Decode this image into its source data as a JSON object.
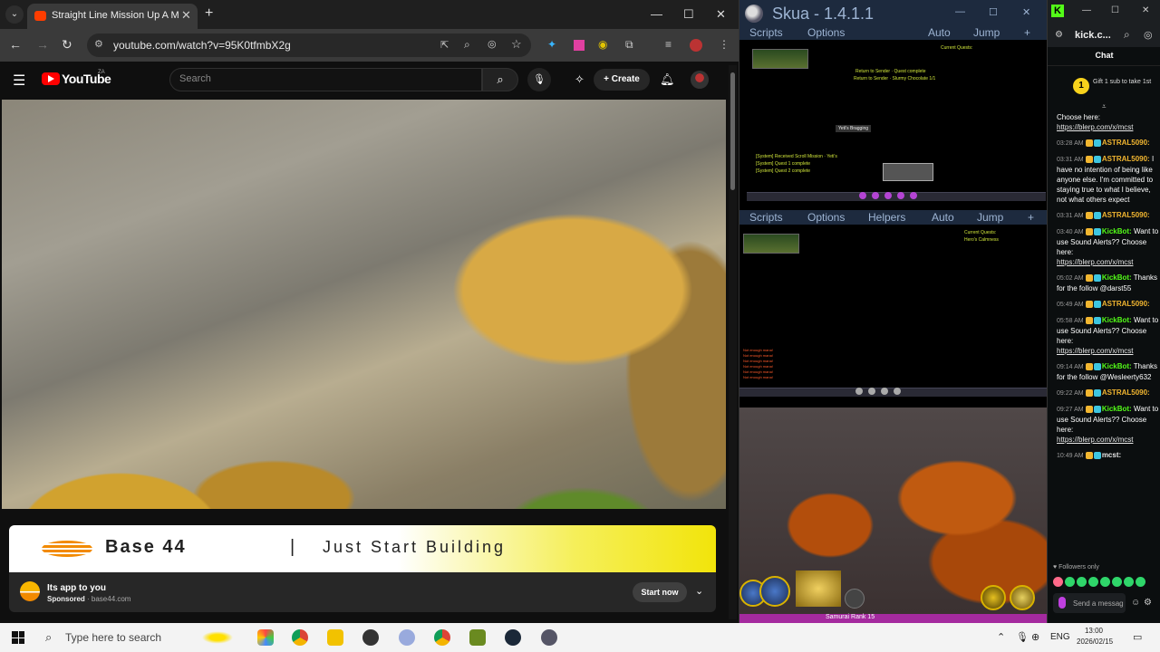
{
  "chrome": {
    "tab_title": "Straight Line Mission Up A M",
    "url": "youtube.com/watch?v=95K0tfmbX2g",
    "minimize_glyph": "—",
    "maximize_glyph": "☐",
    "close_glyph": "✕"
  },
  "youtube": {
    "logo_text": "YouTube",
    "country_code": "ZA",
    "search_placeholder": "Search",
    "create_label": "Create"
  },
  "ad": {
    "brand": "Base 44",
    "separator": "|",
    "slogan": "Just Start Building",
    "title": "Its app to you",
    "sponsored_label": "Sponsored",
    "domain": "base44.com",
    "cta": "Start now"
  },
  "skua": {
    "title": "Skua - 1.4.1.1",
    "menu_top": {
      "scripts": "Scripts",
      "options": "Options",
      "auto": "Auto",
      "jump": "Jump",
      "plus": "+"
    },
    "menu_bottom": {
      "scripts": "Scripts",
      "options": "Options",
      "helpers": "Helpers",
      "auto": "Auto",
      "jump": "Jump",
      "plus": "+"
    },
    "rank_text": "Samurai Rank 15"
  },
  "kick": {
    "url": "kick.c...",
    "chat_title": "Chat",
    "gift_count": "1",
    "gift_text": "Gift 1 sub to take 1st",
    "followers_only": "Followers only",
    "input_placeholder": "Send a message",
    "messages": [
      {
        "time": "",
        "user": "",
        "text": "Choose here:",
        "link": "https://blerp.com/x/mcst"
      },
      {
        "time": "03:28 AM",
        "user": "ASTRAL5090:",
        "text": "",
        "link": ""
      },
      {
        "time": "03:31 AM",
        "user": "ASTRAL5090:",
        "text": "I have no intention of being like anyone else. I'm committed to staying true to what I believe, not what others expect",
        "link": ""
      },
      {
        "time": "03:31 AM",
        "user": "ASTRAL5090:",
        "text": "",
        "link": ""
      },
      {
        "time": "03:40 AM",
        "user": "KickBot:",
        "text": "Want to use Sound Alerts?? Choose here:",
        "link": "https://blerp.com/x/mcst"
      },
      {
        "time": "05:02 AM",
        "user": "KickBot:",
        "text": "Thanks for the follow @darst55",
        "link": ""
      },
      {
        "time": "05:49 AM",
        "user": "ASTRAL5090:",
        "text": "",
        "link": ""
      },
      {
        "time": "05:58 AM",
        "user": "KickBot:",
        "text": "Want to use Sound Alerts?? Choose here:",
        "link": "https://blerp.com/x/mcst"
      },
      {
        "time": "09:14 AM",
        "user": "KickBot:",
        "text": "Thanks for the follow @Wesleerty632",
        "link": ""
      },
      {
        "time": "09:22 AM",
        "user": "ASTRAL5090:",
        "text": "",
        "link": ""
      },
      {
        "time": "09:27 AM",
        "user": "KickBot:",
        "text": "Want to use Sound Alerts?? Choose here:",
        "link": "https://blerp.com/x/mcst"
      },
      {
        "time": "10:49 AM",
        "user": "mcst:",
        "text": "",
        "link": ""
      }
    ]
  },
  "taskbar": {
    "search_placeholder": "Type here to search",
    "language": "ENG",
    "time": "13:00",
    "date": "2026/02/15"
  },
  "colors": {
    "youtube_red": "#ff0000",
    "kick_green": "#53fc18",
    "skua_title_bg": "#1d2a3e",
    "skua_text": "#9db4d3",
    "astral_user": "#f2b630",
    "kickbot_user": "#53fc18",
    "mcst_user": "#e8e8e8"
  }
}
